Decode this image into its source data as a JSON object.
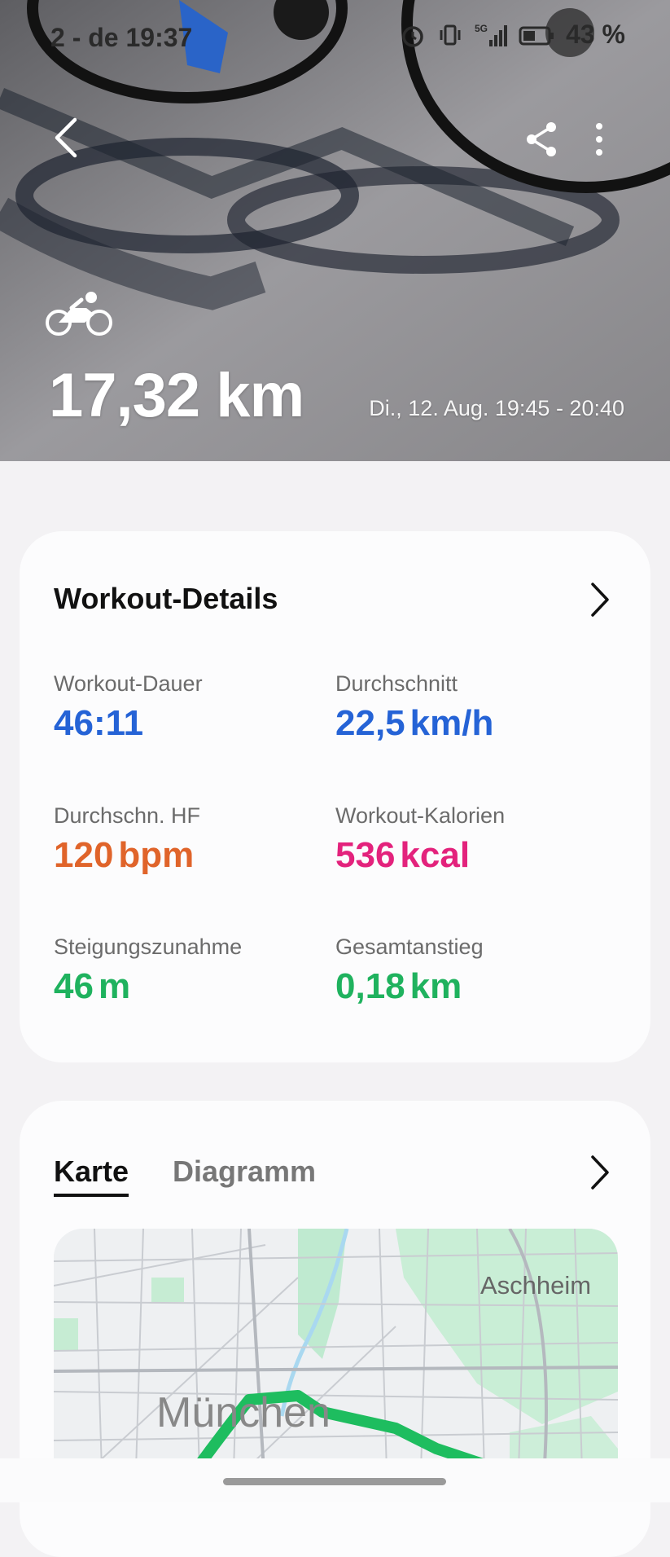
{
  "status_bar": {
    "time": "2 - de 19:37",
    "battery": "43 %",
    "icons": [
      "alarm-icon",
      "vibrate-icon",
      "signal-5g-icon",
      "battery-icon"
    ]
  },
  "hero": {
    "distance": "17,32 km",
    "datetime": "Di., 12. Aug. 19:45 - 20:40",
    "activity_icon": "cycling-icon"
  },
  "workout_details": {
    "title": "Workout-Details",
    "metrics": [
      {
        "label": "Workout-Dauer",
        "value": "46:11",
        "unit": "",
        "color": "#2563d6"
      },
      {
        "label": "Durchschnitt",
        "value": "22,5",
        "unit": "km/h",
        "color": "#2563d6"
      },
      {
        "label": "Durchschn. HF",
        "value": "120",
        "unit": "bpm",
        "color": "#e0642a"
      },
      {
        "label": "Workout-Kalorien",
        "value": "536",
        "unit": "kcal",
        "color": "#e3227c"
      },
      {
        "label": "Steigungszunahme",
        "value": "46",
        "unit": "m",
        "color": "#1fb25e"
      },
      {
        "label": "Gesamtanstieg",
        "value": "0,18",
        "unit": "km",
        "color": "#1fb25e"
      }
    ]
  },
  "map_card": {
    "tabs": [
      {
        "label": "Karte",
        "active": true
      },
      {
        "label": "Diagramm",
        "active": false
      }
    ],
    "map_labels": {
      "aschheim": "Aschheim",
      "munich": "München"
    }
  }
}
